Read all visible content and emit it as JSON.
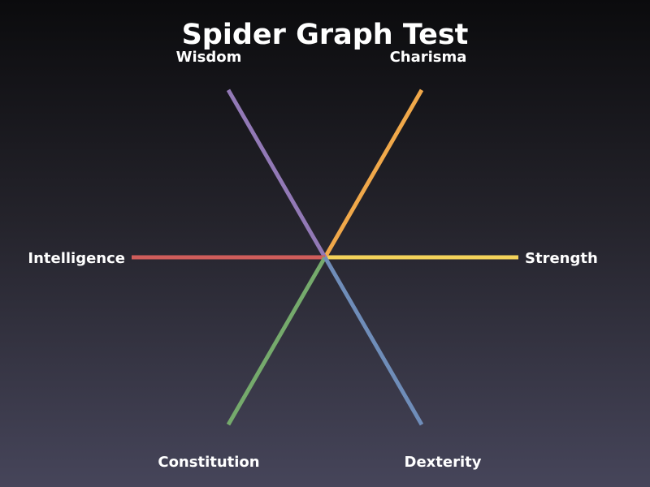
{
  "chart_data": {
    "type": "radar",
    "title": "Spider Graph Test",
    "axes": [
      {
        "name": "Strength",
        "color": "#f3d25a"
      },
      {
        "name": "Charisma",
        "color": "#f0a84a"
      },
      {
        "name": "Wisdom",
        "color": "#9279b6"
      },
      {
        "name": "Intelligence",
        "color": "#cf5d5b"
      },
      {
        "name": "Constitution",
        "color": "#75aa6c"
      },
      {
        "name": "Dexterity",
        "color": "#6f8db9"
      }
    ],
    "grid": false,
    "legend": "none"
  }
}
